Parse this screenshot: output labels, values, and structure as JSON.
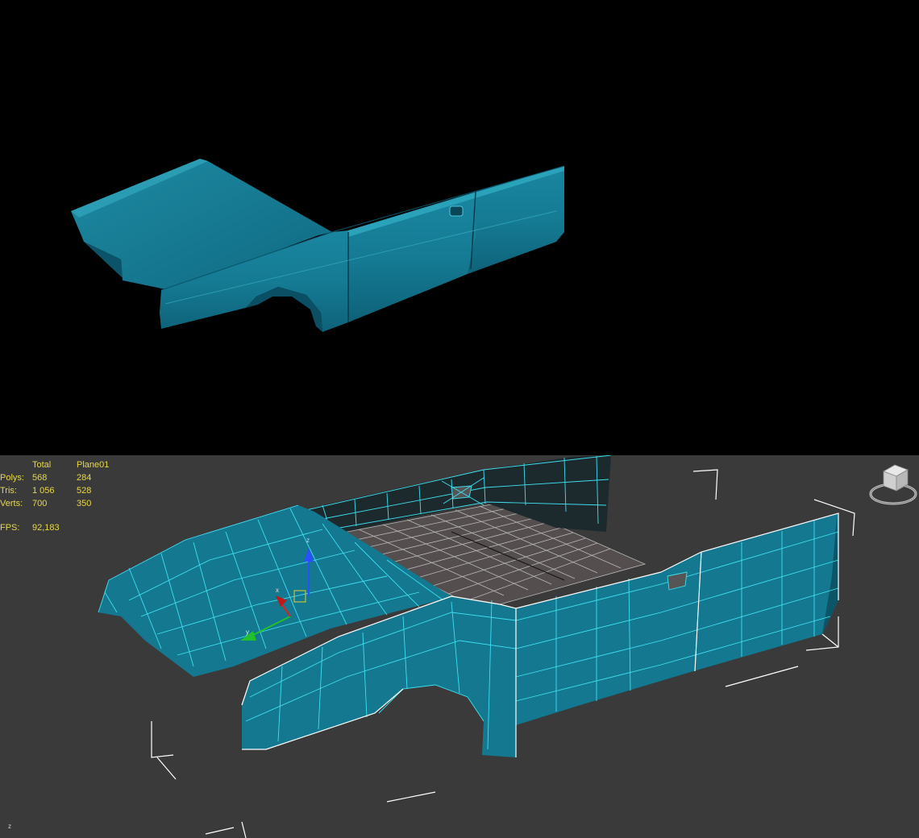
{
  "stats": {
    "headers": [
      "Total",
      "Plane01"
    ],
    "rows": [
      {
        "label": "Polys:",
        "total": "568",
        "object": "284"
      },
      {
        "label": "Tris:",
        "total": "1 056",
        "object": "528"
      },
      {
        "label": "Verts:",
        "total": "700",
        "object": "350"
      }
    ],
    "fps_label": "FPS:",
    "fps_value": "92,183"
  },
  "colors": {
    "mesh": "#137890",
    "wire": "#3fe0f2",
    "bbox": "#ffffff",
    "grid": "#d8d8d8",
    "viewport_bg": "#3a3a3a",
    "stats_text": "#e8d84a"
  },
  "icons": {
    "viewcube": "viewcube-icon",
    "gizmo": "transform-gizmo-icon"
  },
  "gizmo_labels": {
    "z": "z",
    "x": "x",
    "y": "y"
  },
  "corner_axis_label": "z"
}
